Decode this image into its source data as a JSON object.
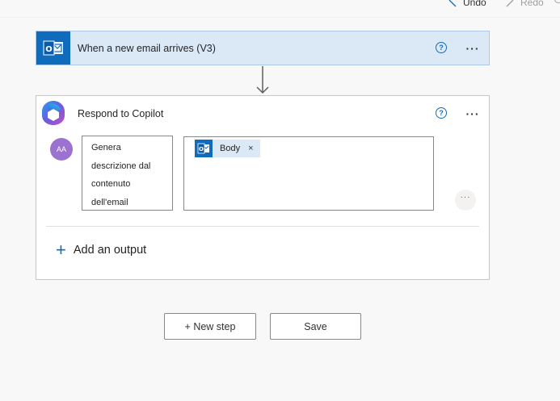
{
  "toolbar": {
    "undo_label": "Undo",
    "redo_label": "Redo"
  },
  "trigger": {
    "title": "When a new email arrives (V3)",
    "icon": "outlook-icon"
  },
  "action": {
    "title": "Respond to Copilot",
    "icon": "copilot-icon",
    "output": {
      "type_icon": "text-type-icon",
      "type_text": "AA",
      "name_lines": [
        "Genera",
        "descrizione dal",
        "contenuto",
        "dell'email"
      ],
      "token_label": "Body",
      "token_close": "×"
    },
    "add_output_label": "Add an output"
  },
  "buttons": {
    "new_step": "+ New step",
    "save": "Save"
  },
  "colors": {
    "accent": "#0f6cbd",
    "trigger_bg": "#dbe9f7",
    "avatar_bg": "#9b72cf"
  }
}
